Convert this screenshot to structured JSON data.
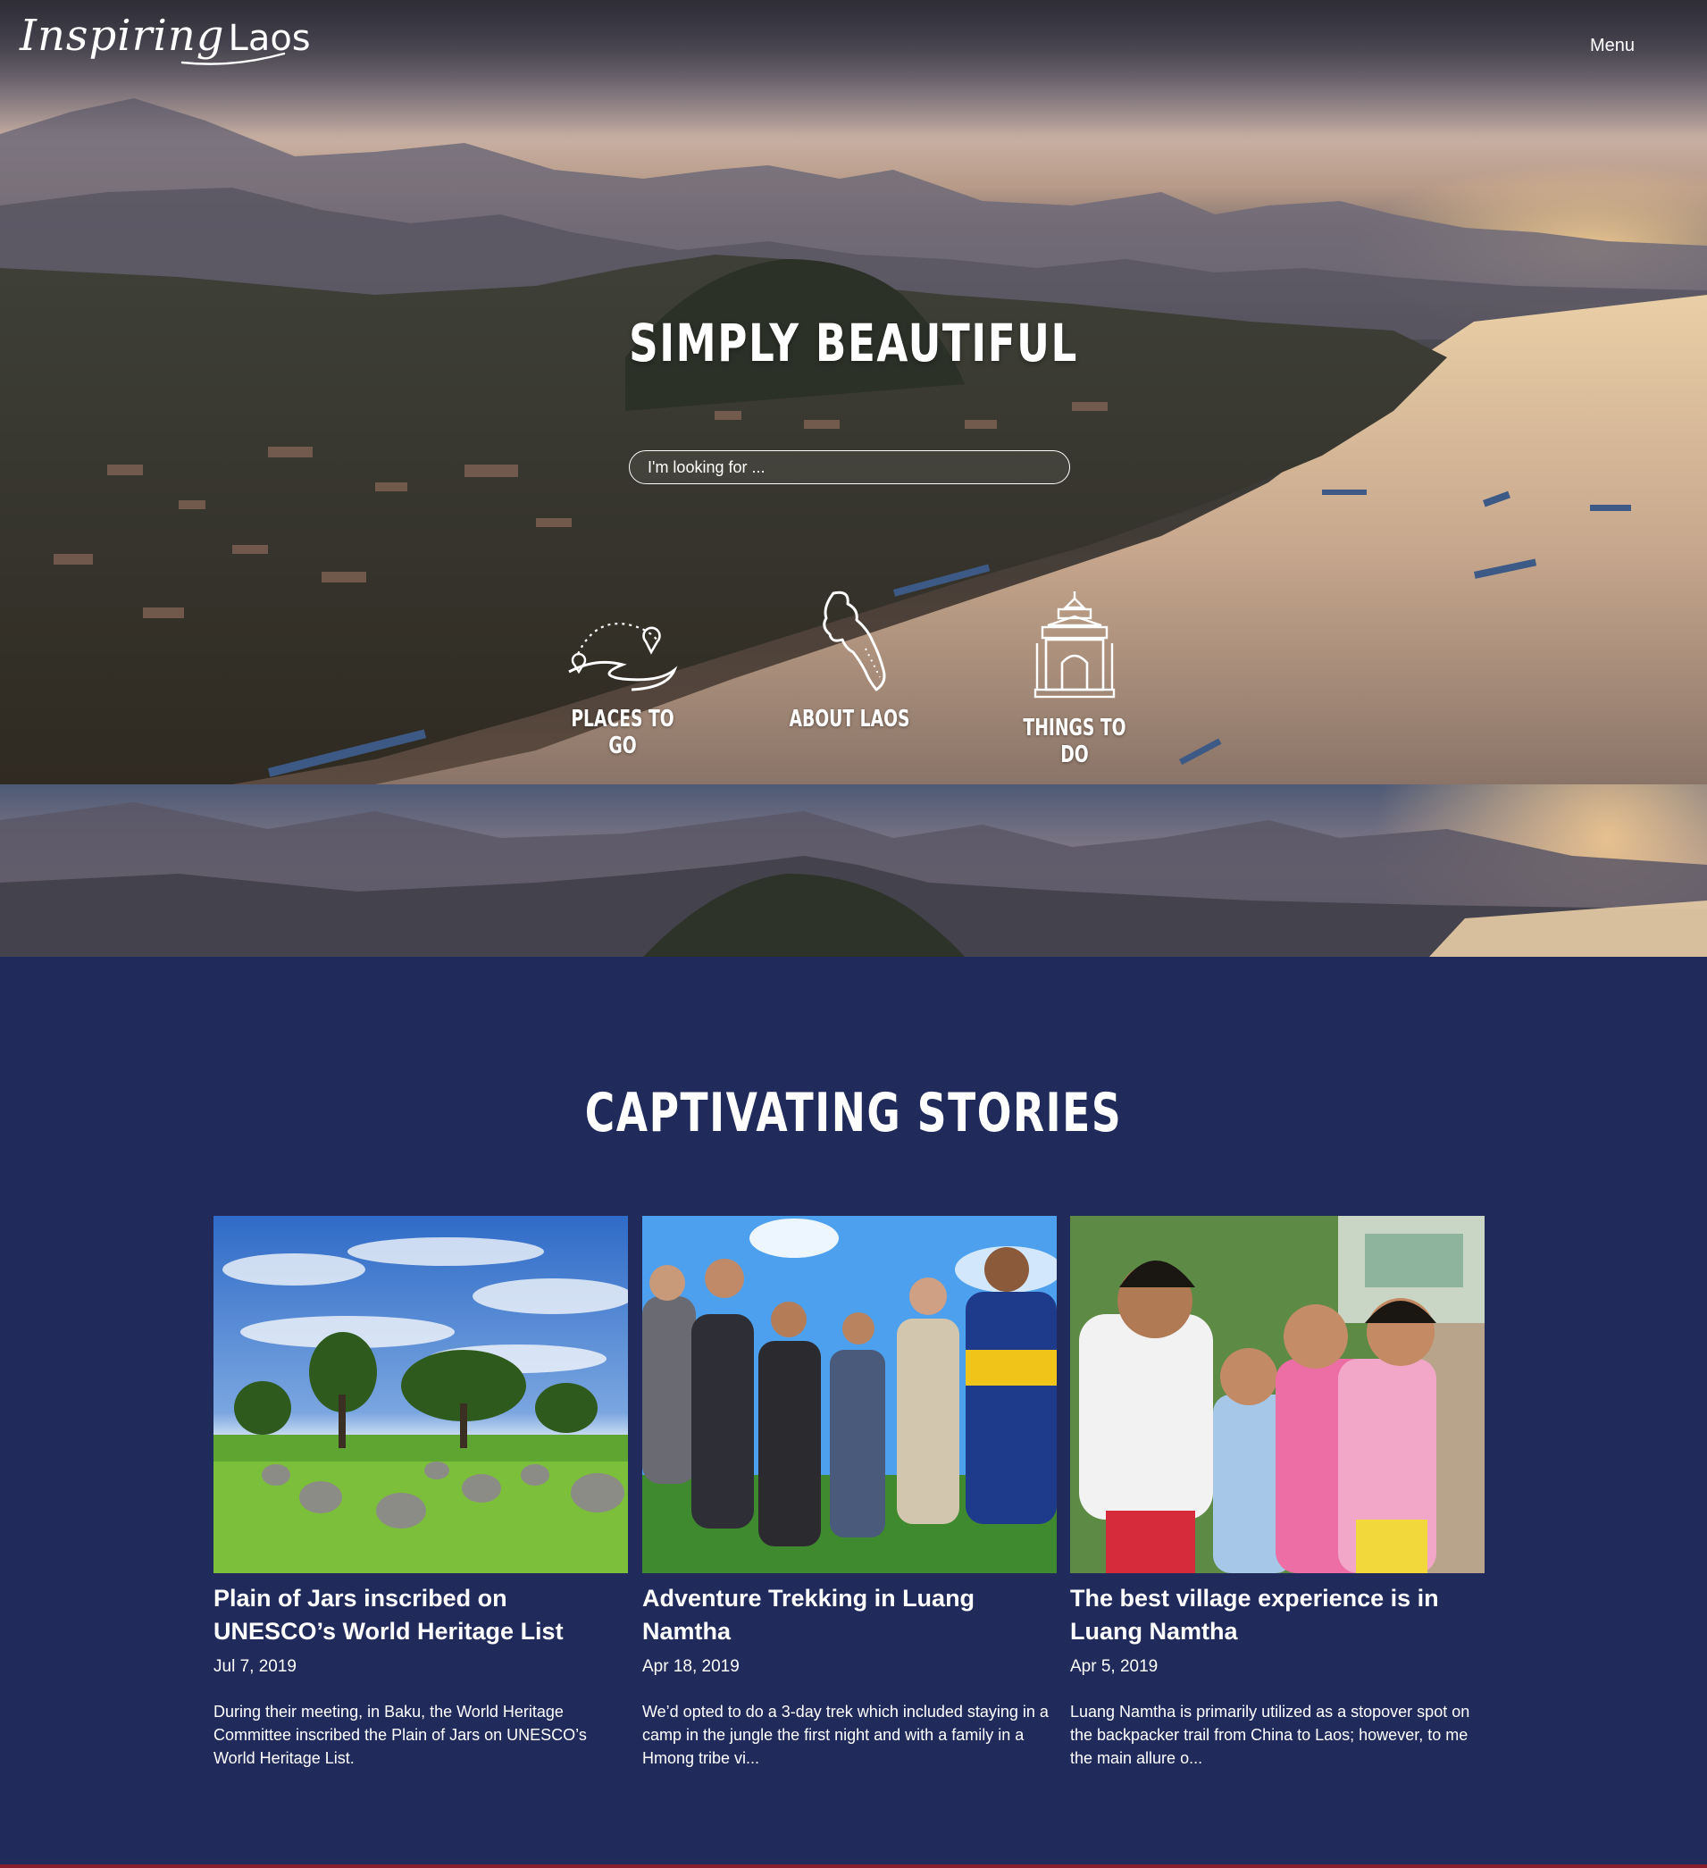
{
  "header": {
    "logo_part1": "Inspiring",
    "logo_part2": "Laos",
    "menu_label": "Menu"
  },
  "hero": {
    "title": "SIMPLY BEAUTIFUL",
    "search_placeholder": "I'm looking for ...",
    "categories": [
      {
        "label": "PLACES TO GO",
        "icon": "route-pins-icon"
      },
      {
        "label": "ABOUT LAOS",
        "icon": "laos-map-icon"
      },
      {
        "label": "THINGS TO DO",
        "icon": "temple-gate-icon"
      }
    ]
  },
  "stories": {
    "heading": "CAPTIVATING STORIES",
    "items": [
      {
        "title": "Plain of Jars inscribed on UNESCO’s World Heritage List",
        "date": "Jul 7, 2019",
        "excerpt": "During their meeting, in Baku, the World Heritage Committee inscribed the Plain of Jars on UNESCO’s World Heritage List."
      },
      {
        "title": "Adventure Trekking in Luang Namtha",
        "date": "Apr 18, 2019",
        "excerpt": "We’d opted to do a 3-day trek which included staying in a camp in the jungle the first night and with a family in a Hmong tribe vi..."
      },
      {
        "title": "The best village experience is in Luang Namtha",
        "date": "Apr 5, 2019",
        "excerpt": "Luang Namtha is primarily utilized as a stopover spot on the backpacker trail from China to Laos; however, to me the main allure o..."
      }
    ]
  },
  "colors": {
    "navy_background": "#202a5b",
    "text_white": "#ffffff",
    "bottom_accent": "#8a1d2c"
  }
}
